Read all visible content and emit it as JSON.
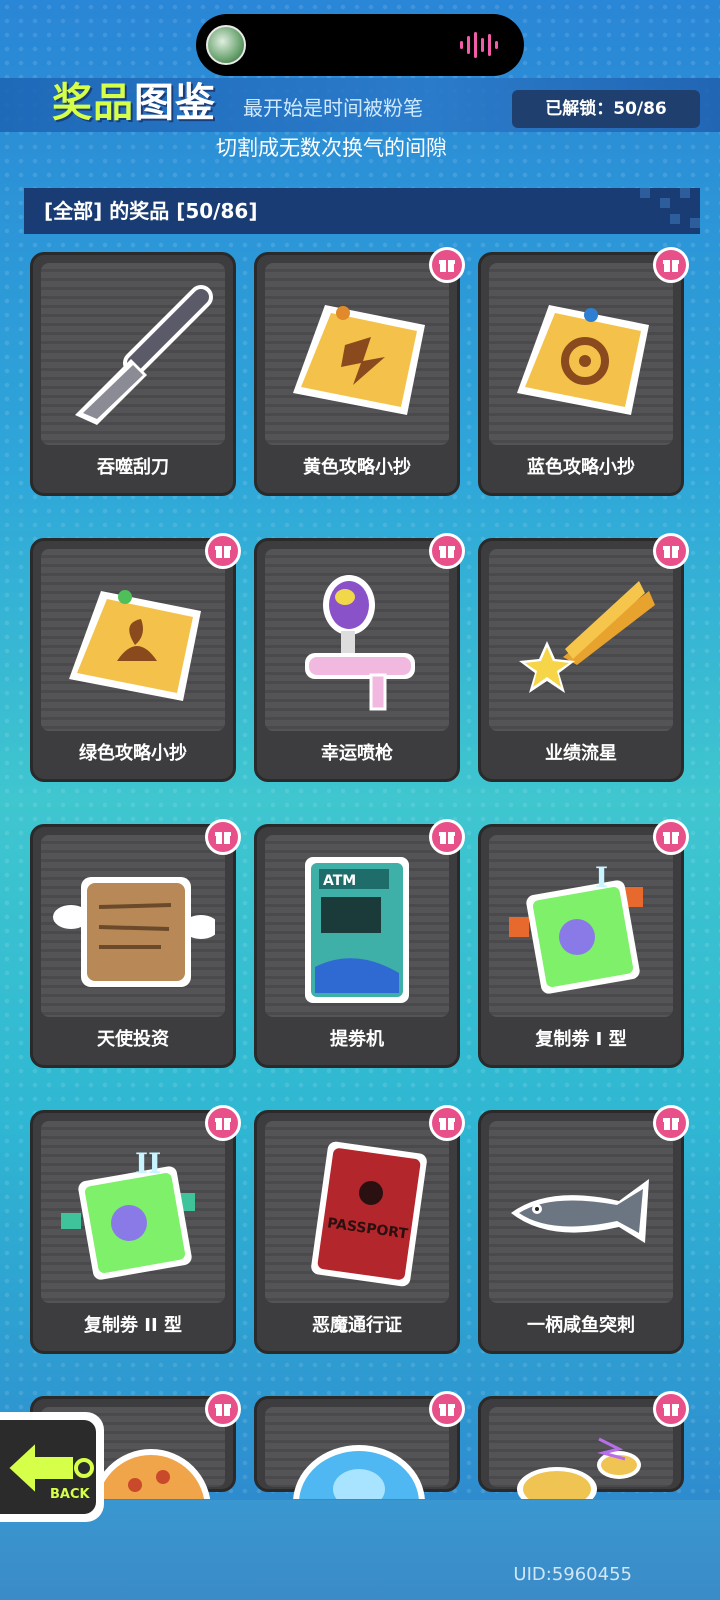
{
  "header": {
    "title_part1": "奖品",
    "title_part2": "图鉴",
    "unlocked_label": "已解锁：50/86"
  },
  "lyrics": {
    "line1": "最开始是时间被粉笔",
    "line2": "切割成无数次换气的间隙"
  },
  "section": {
    "title": "[全部] 的奖品 [50/86]"
  },
  "items": [
    {
      "label": "吞噬刮刀",
      "icon": "scraper-icon",
      "has_gift": false
    },
    {
      "label": "黄色攻略小抄",
      "icon": "yellow-note-icon",
      "has_gift": true
    },
    {
      "label": "蓝色攻略小抄",
      "icon": "blue-note-icon",
      "has_gift": true
    },
    {
      "label": "绿色攻略小抄",
      "icon": "green-note-icon",
      "has_gift": true
    },
    {
      "label": "幸运喷枪",
      "icon": "spray-gun-icon",
      "has_gift": true
    },
    {
      "label": "业绩流星",
      "icon": "shooting-star-icon",
      "has_gift": true
    },
    {
      "label": "天使投资",
      "icon": "winged-scroll-icon",
      "has_gift": true
    },
    {
      "label": "提劵机",
      "icon": "atm-icon",
      "has_gift": true
    },
    {
      "label": "复制劵 I 型",
      "icon": "ticket-1-icon",
      "has_gift": true
    },
    {
      "label": "复制劵 II 型",
      "icon": "ticket-2-icon",
      "has_gift": true
    },
    {
      "label": "恶魔通行证",
      "icon": "passport-icon",
      "has_gift": true
    },
    {
      "label": "一柄咸鱼突刺",
      "icon": "salted-fish-icon",
      "has_gift": true
    },
    {
      "label": "",
      "icon": "pizza-icon",
      "has_gift": true
    },
    {
      "label": "",
      "icon": "bubble-icon",
      "has_gift": true
    },
    {
      "label": "",
      "icon": "mushroom-icon",
      "has_gift": true
    }
  ],
  "passport_text": "PASSPORT",
  "atm_text": "ATM",
  "back_text": "BACK",
  "uid": "UID:5960455",
  "colors": {
    "card_bg": "#3d3d3f",
    "gift_badge": "#e8508a",
    "section_bar": "#183c73",
    "title_accent": "#d6ff4a"
  }
}
